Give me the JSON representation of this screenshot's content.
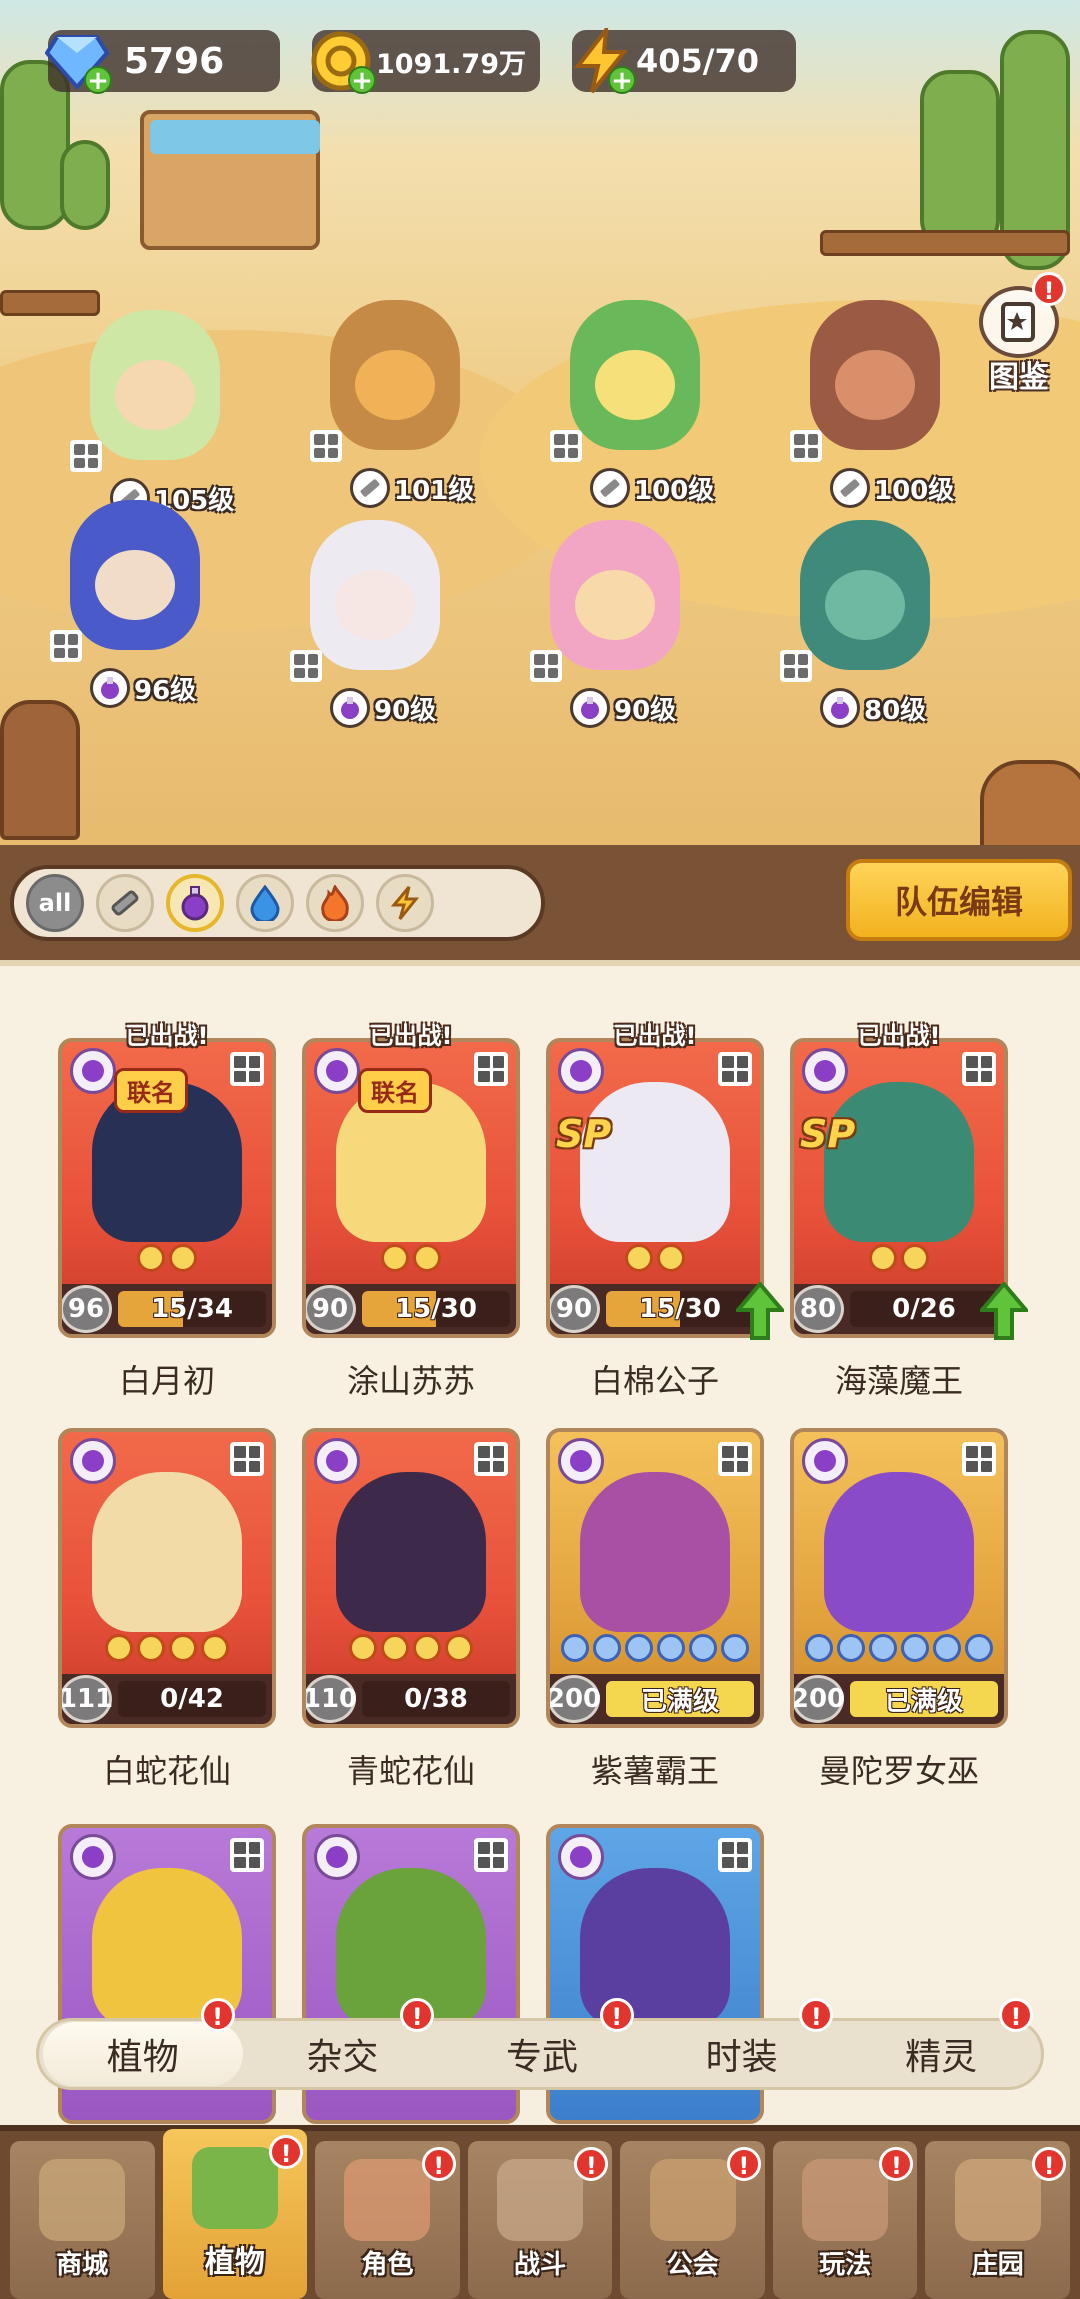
{
  "resources": {
    "gems": "5796",
    "coins": "1091.79万",
    "energy": "405/70"
  },
  "album": {
    "label": "图鉴",
    "badge": "!"
  },
  "lineup": [
    {
      "level": "105级",
      "level_icon": "sword-icon",
      "color": "#cfe7a4",
      "face": "#f6d8b0"
    },
    {
      "level": "101级",
      "level_icon": "sword-icon",
      "color": "#c58a45",
      "face": "#f1b156"
    },
    {
      "level": "100级",
      "level_icon": "sword-icon",
      "color": "#69b95a",
      "face": "#f6e07a"
    },
    {
      "level": "100级",
      "level_icon": "sword-icon",
      "color": "#9b5a44",
      "face": "#d98f6a"
    },
    {
      "level": "96级",
      "level_icon": "potion-icon",
      "color": "#4a5ac8",
      "face": "#f1dcc8"
    },
    {
      "level": "90级",
      "level_icon": "potion-icon",
      "color": "#eeeaf2",
      "face": "#f7e7e4"
    },
    {
      "level": "90级",
      "level_icon": "potion-icon",
      "color": "#f3a6c4",
      "face": "#f8d9a9"
    },
    {
      "level": "80级",
      "level_icon": "potion-icon",
      "color": "#3f8a7a",
      "face": "#6fb8a2"
    }
  ],
  "filters": {
    "all_label": "all",
    "items": [
      "all",
      "sword-icon",
      "potion-icon",
      "water-drop-icon",
      "fire-icon",
      "lightning-icon"
    ],
    "selected": "potion-icon"
  },
  "team_button": "队伍编辑",
  "cards": [
    {
      "name": "白月初",
      "level": "96",
      "progress": "15/34",
      "fill": 0.44,
      "deployed": "已出战!",
      "tag": "联名",
      "style": "red",
      "art": "#283056",
      "up": false
    },
    {
      "name": "涂山苏苏",
      "level": "90",
      "progress": "15/30",
      "fill": 0.5,
      "deployed": "已出战!",
      "tag": "联名",
      "style": "red",
      "art": "#f5d97a",
      "up": false
    },
    {
      "name": "白棉公子",
      "level": "90",
      "progress": "15/30",
      "fill": 0.5,
      "deployed": "已出战!",
      "tag": "SP",
      "style": "red",
      "art": "#ece9f2",
      "up": true
    },
    {
      "name": "海藻魔王",
      "level": "80",
      "progress": "0/26",
      "fill": 0.0,
      "deployed": "已出战!",
      "tag": "SP",
      "style": "red",
      "art": "#3b8a74",
      "up": true
    },
    {
      "name": "白蛇花仙",
      "level": "111",
      "progress": "0/42",
      "fill": 0.0,
      "deployed": "",
      "tag": "",
      "style": "red",
      "art": "#f3dba8",
      "up": false
    },
    {
      "name": "青蛇花仙",
      "level": "110",
      "progress": "0/38",
      "fill": 0.0,
      "deployed": "",
      "tag": "",
      "style": "red",
      "art": "#3d2a4a",
      "up": false
    },
    {
      "name": "紫薯霸王",
      "level": "200",
      "progress": "已满级",
      "fill": 1.0,
      "deployed": "",
      "tag": "",
      "style": "gold",
      "art": "#a94fa4",
      "up": false
    },
    {
      "name": "曼陀罗女巫",
      "level": "200",
      "progress": "已满级",
      "fill": 1.0,
      "deployed": "",
      "tag": "",
      "style": "gold",
      "art": "#8a4bc9",
      "up": false
    },
    {
      "name": "",
      "level": "",
      "progress": "",
      "fill": 0,
      "deployed": "",
      "tag": "",
      "style": "purple",
      "art": "#f0c43f",
      "up": false
    },
    {
      "name": "",
      "level": "",
      "progress": "",
      "fill": 0,
      "deployed": "",
      "tag": "",
      "style": "purple",
      "art": "#6aa33b",
      "up": false
    },
    {
      "name": "",
      "level": "",
      "progress": "",
      "fill": 0,
      "deployed": "",
      "tag": "",
      "style": "blue",
      "art": "#5a3fa0",
      "up": false
    }
  ],
  "subtabs": [
    "植物",
    "杂交",
    "专武",
    "时装",
    "精灵"
  ],
  "subtab_active": "植物",
  "nav": [
    {
      "label": "商城",
      "icon": "shop-icon",
      "badge": ""
    },
    {
      "label": "植物",
      "icon": "plants-icon",
      "badge": "!"
    },
    {
      "label": "角色",
      "icon": "character-icon",
      "badge": "!"
    },
    {
      "label": "战斗",
      "icon": "battle-icon",
      "badge": "!"
    },
    {
      "label": "公会",
      "icon": "guild-icon",
      "badge": "!"
    },
    {
      "label": "玩法",
      "icon": "gameplay-icon",
      "badge": "!"
    },
    {
      "label": "庄园",
      "icon": "manor-icon",
      "badge": "!"
    }
  ],
  "nav_active": "植物"
}
